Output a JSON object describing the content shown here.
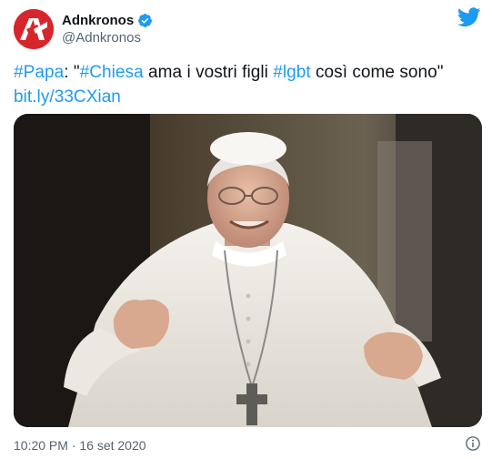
{
  "author": {
    "display_name": "Adnkronos",
    "handle": "@Adnkronos",
    "verified": true,
    "avatar_icon": "adnkronos-logo",
    "brand_color": "#d6262c"
  },
  "tweet": {
    "hashtag_1": "#Papa",
    "text_1": ": \"",
    "hashtag_2": "#Chiesa",
    "text_2": " ama i vostri figli ",
    "hashtag_3": "#lgbt",
    "text_3": " così come sono\"",
    "link": "bit.ly/33CXian"
  },
  "media": {
    "type": "photo",
    "description_icon": "photo"
  },
  "footer": {
    "timestamp": "10:20 PM · 16 set 2020",
    "info_icon": "info-icon"
  },
  "colors": {
    "link": "#1d9bf0",
    "text": "#0f1419",
    "secondary": "#536471",
    "twitter_blue": "#1d9bf0"
  }
}
